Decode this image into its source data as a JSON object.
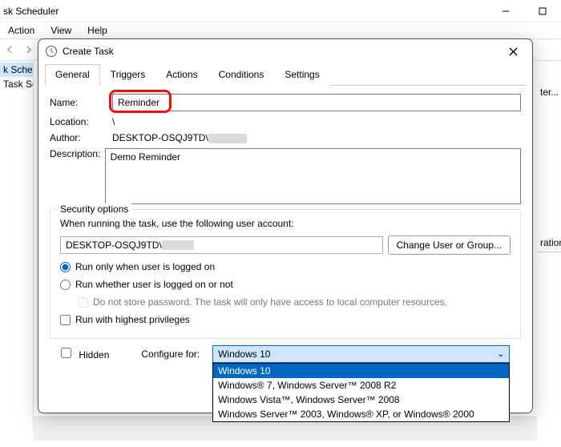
{
  "mainWindow": {
    "title": "sk Scheduler",
    "menus": [
      "Action",
      "View",
      "Help"
    ]
  },
  "tree": {
    "item0": "k Sched",
    "item1": "Task Sc"
  },
  "rightPane": {
    "trail": "ter...",
    "header": "ration"
  },
  "dialog": {
    "title": "Create Task"
  },
  "tabs": {
    "t0": "General",
    "t1": "Triggers",
    "t2": "Actions",
    "t3": "Conditions",
    "t4": "Settings"
  },
  "labels": {
    "name": "Name:",
    "location": "Location:",
    "author": "Author:",
    "description": "Description:",
    "securityLegend": "Security options",
    "userAccount": "When running the task, use the following user account:",
    "changeUser": "Change User or Group...",
    "radioLoggedOn": "Run only when user is logged on",
    "radioAnytime": "Run whether user is logged on or not",
    "noStore": "Do not store password.  The task will only have access to local computer resources.",
    "highest": "Run with highest privileges",
    "hidden": "Hidden",
    "configureFor": "Configure for:"
  },
  "values": {
    "name": "Reminder",
    "location": "\\",
    "author": "DESKTOP-OSQJ9TD\\",
    "description": "Demo Reminder",
    "account": "DESKTOP-OSQJ9TD\\",
    "configureSelected": "Windows 10"
  },
  "options": {
    "o0": "Windows 10",
    "o1": "Windows® 7, Windows Server™ 2008 R2",
    "o2": "Windows Vista™, Windows Server™ 2008",
    "o3": "Windows Server™ 2003, Windows® XP, or Windows® 2000"
  }
}
